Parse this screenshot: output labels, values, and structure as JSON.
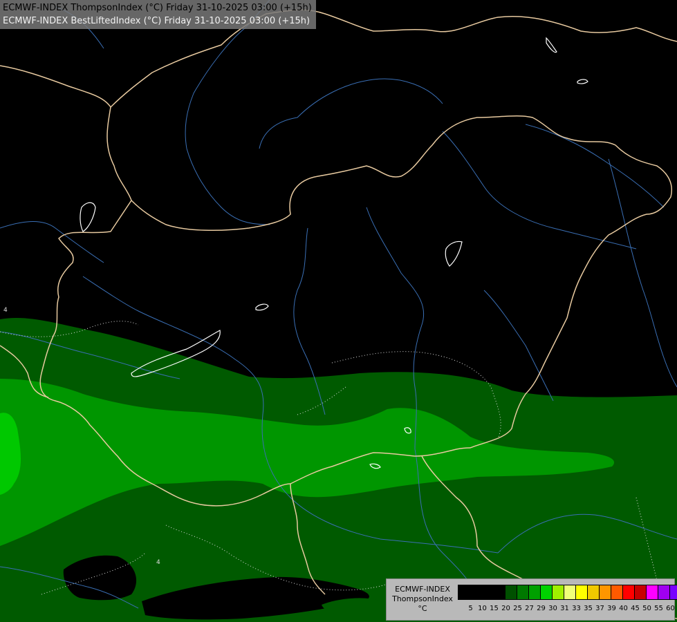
{
  "header": {
    "line1": "ECMWF-INDEX ThompsonIndex (°C) Friday 31-10-2025 03:00 (+15h)",
    "line2": "ECMWF-INDEX BestLiftedIndex (°C) Friday 31-10-2025 03:00 (+15h)"
  },
  "legend": {
    "line1": "ECMWF-INDEX",
    "line2": "ThompsonIndex",
    "line3": "°C",
    "colors": [
      "#000000",
      "#000000",
      "#000000",
      "#000000",
      "#005000",
      "#007800",
      "#00a000",
      "#00d200",
      "#a0f000",
      "#f0ff78",
      "#ffff00",
      "#f0c800",
      "#ff9600",
      "#ff5a00",
      "#ff0000",
      "#c80000",
      "#ff00ff",
      "#a000f0",
      "#7800ff",
      "#5a00ff",
      "#0000ff"
    ],
    "ticks": [
      "5",
      "10",
      "15",
      "20",
      "25",
      "27",
      "29",
      "30",
      "31",
      "33",
      "35",
      "37",
      "39",
      "40",
      "45",
      "50",
      "55",
      "60"
    ]
  },
  "map_annotations": {
    "contour_label_1": "4",
    "contour_label_2": "4"
  }
}
